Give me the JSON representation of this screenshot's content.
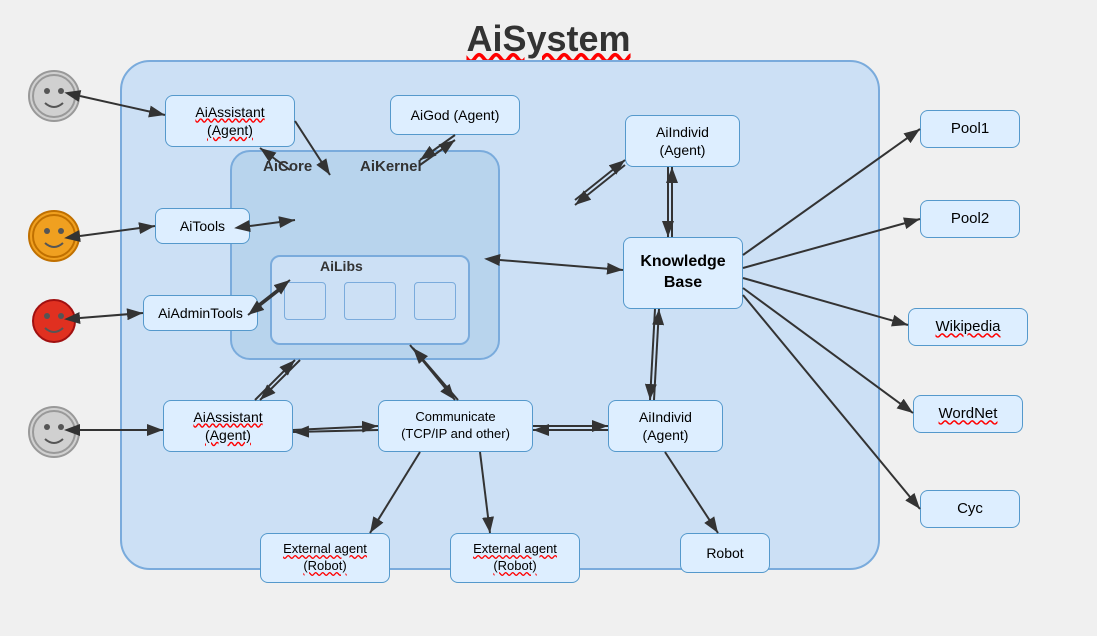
{
  "title": "AiSystem",
  "nodes": {
    "aiAssistantTop": "AiAssistant\n(Agent)",
    "aiGod": "AiGod (Agent)",
    "aiIndividTop": "AiIndivid\n(Agent)",
    "aiTools": "AiTools",
    "aiCore": "AiCore",
    "aiKernel": "AiKernel",
    "aiLibs": "AiLibs",
    "aiAdminTools": "AiAdminTools",
    "knowledgeBase": "Knowledge\nBase",
    "aiAssistantBottom": "AiAssistant\n(Agent)",
    "communicate": "Communicate\n(TCP/IP and other)",
    "aiIndividBottom": "AiIndivid\n(Agent)",
    "externalAgentLeft": "External agent\n(Robot)",
    "externalAgentRight": "External agent\n(Robot)",
    "robot": "Robot",
    "pool1": "Pool1",
    "pool2": "Pool2",
    "wikipedia": "Wikipedia",
    "wordnet": "WordNet",
    "cyc": "Cyc"
  },
  "smileys": [
    {
      "id": "smiley1",
      "type": "gray",
      "label": "😊"
    },
    {
      "id": "smiley2",
      "type": "orange",
      "label": "😊"
    },
    {
      "id": "smiley3",
      "type": "red",
      "label": "😊"
    },
    {
      "id": "smiley4",
      "type": "gray",
      "label": "😊"
    }
  ],
  "colors": {
    "bg": "#f0f0f0",
    "systemBox": "#cce0f5",
    "nodeBg": "#ddeeff",
    "nodeBorder": "#5599cc",
    "arrowColor": "#333333"
  }
}
